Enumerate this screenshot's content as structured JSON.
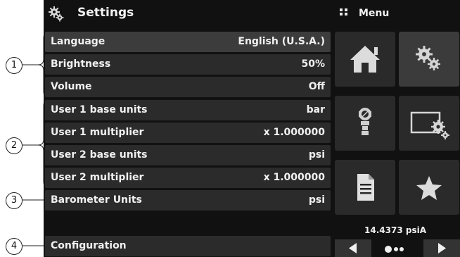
{
  "header": {
    "title": "Settings",
    "menu_label": "Menu"
  },
  "rows": [
    {
      "label": "Language",
      "value": "English (U.S.A.)"
    },
    {
      "label": "Brightness",
      "value": "50%"
    },
    {
      "label": "Volume",
      "value": "Off"
    },
    {
      "label": "User 1 base units",
      "value": "bar"
    },
    {
      "label": "User 1 multiplier",
      "value": "x 1.000000"
    },
    {
      "label": "User 2 base units",
      "value": "psi"
    },
    {
      "label": "User 2 multiplier",
      "value": "x 1.000000"
    },
    {
      "label": "Barometer Units",
      "value": "psi"
    },
    {
      "label": "Configuration",
      "value": ""
    }
  ],
  "callouts": [
    "1",
    "2",
    "3",
    "4"
  ],
  "tiles": [
    "home-icon",
    "settings-gears-icon",
    "pressure-transducer-icon",
    "display-settings-icon",
    "document-icon",
    "favorites-star-icon"
  ],
  "status": {
    "reading": "14.4373 psiA",
    "page": 1,
    "page_count": 3
  },
  "colors": {
    "screen_bg": "#111111",
    "row_bg": "#2b2b2b",
    "tile_bg": "#2a2a2a",
    "text": "#f0f0f0"
  }
}
